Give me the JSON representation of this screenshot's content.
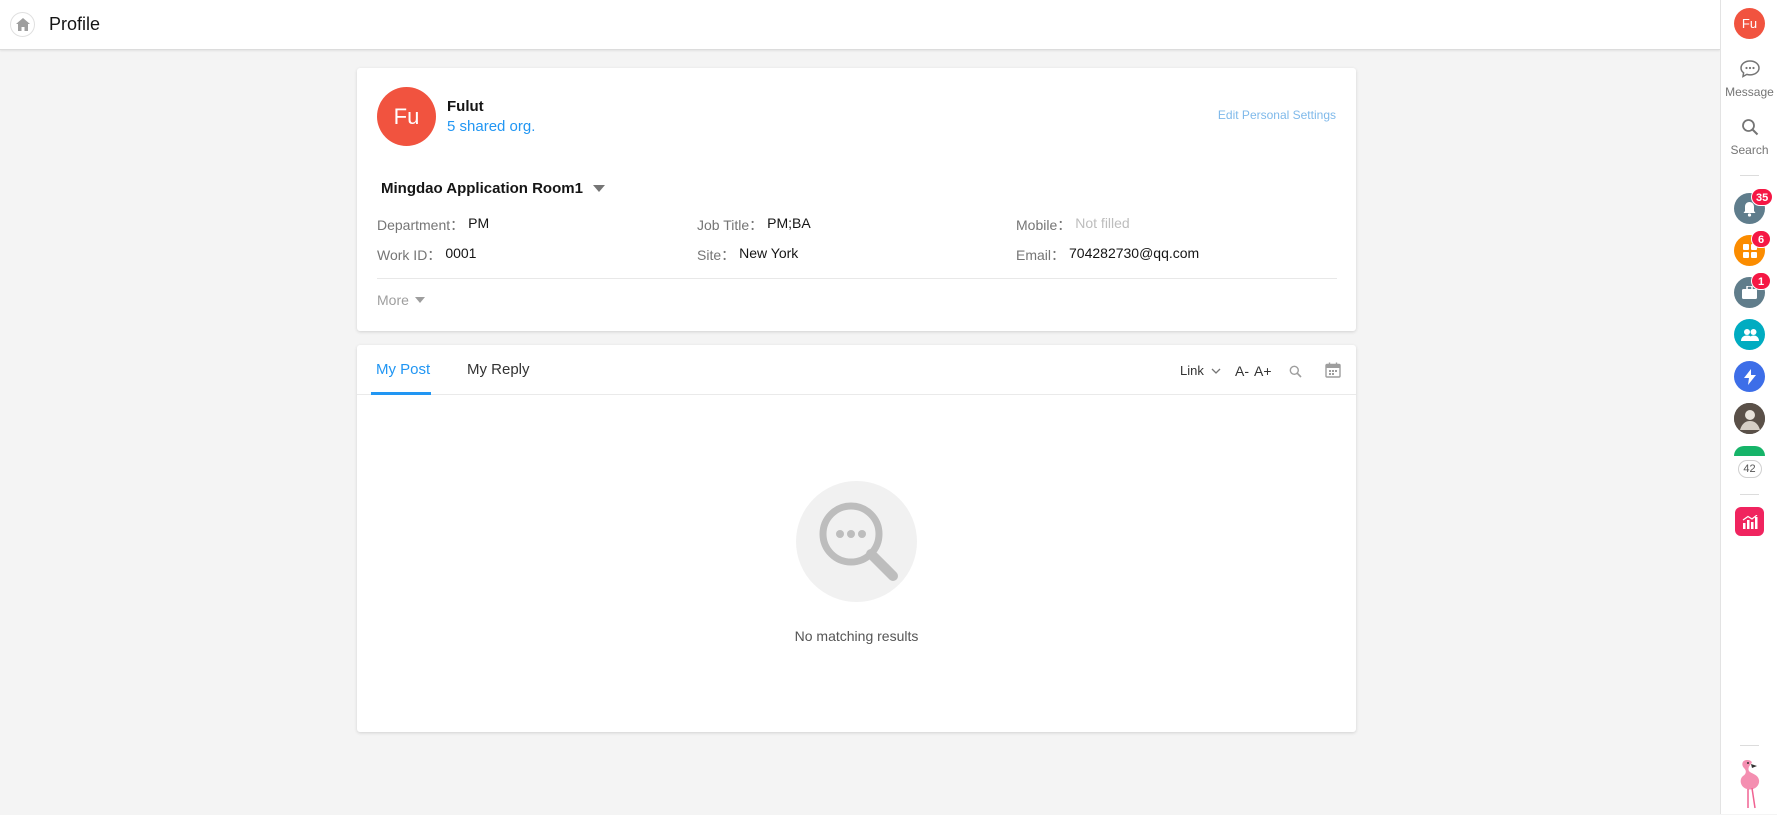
{
  "header": {
    "title": "Profile"
  },
  "sidebar": {
    "user_initials": "Fu",
    "message_label": "Message",
    "search_label": "Search",
    "badges": {
      "notifications": "35",
      "apps": "6",
      "work": "1"
    },
    "more_count": "42"
  },
  "profile": {
    "initials": "Fu",
    "name": "Fulut",
    "shared_org": "5 shared org.",
    "edit_settings": "Edit Personal Settings",
    "organization": "Mingdao Application Room1",
    "fields": {
      "department_label": "Department：",
      "department": "PM",
      "job_title_label": "Job Title：",
      "job_title": "PM;BA",
      "mobile_label": "Mobile：",
      "mobile": "Not filled",
      "work_id_label": "Work ID：",
      "work_id": "0001",
      "site_label": "Site：",
      "site": "New York",
      "email_label": "Email：",
      "email": "704282730@qq.com"
    },
    "more_label": "More"
  },
  "posts": {
    "tabs": [
      {
        "label": "My Post"
      },
      {
        "label": "My Reply"
      }
    ],
    "toolbar": {
      "link_label": "Link",
      "font_decrease": "A-",
      "font_increase": "A+"
    },
    "empty_text": "No matching results"
  },
  "colors": {
    "accent": "#2196f3",
    "avatar": "#f1533f",
    "badge": "#f51744"
  }
}
